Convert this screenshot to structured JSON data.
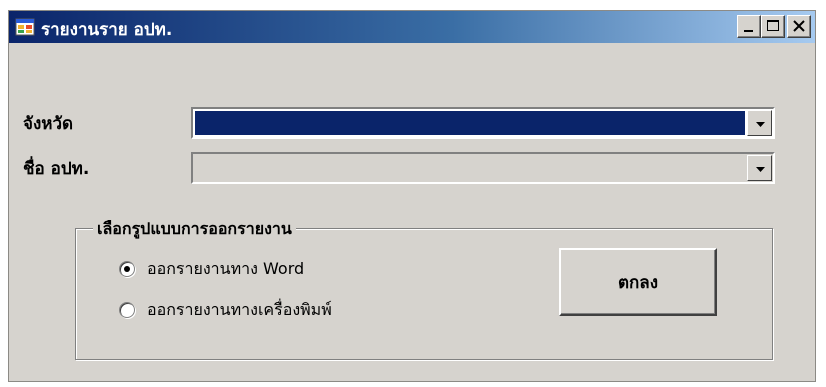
{
  "window": {
    "title": "รายงานราย อปท.",
    "icon": "app-window-icon",
    "controls": {
      "minimize": "minimize-icon",
      "maximize": "maximize-icon",
      "close": "close-icon"
    }
  },
  "form": {
    "province_label": "จังหวัด",
    "province_value": "",
    "province_selected_color": "#0a246a",
    "org_label": "ชื่อ อปท.",
    "org_value": ""
  },
  "report_group": {
    "title": "เลือกรูปแบบการออกรายงาน",
    "options": [
      {
        "label": "ออกรายงานทาง Word",
        "selected": true
      },
      {
        "label": "ออกรายงานทางเครื่องพิมพ์",
        "selected": false
      }
    ],
    "ok_label": "ตกลง"
  },
  "colors": {
    "face": "#d6d3ce",
    "title_start": "#0a246a",
    "title_end": "#a6caf0"
  }
}
